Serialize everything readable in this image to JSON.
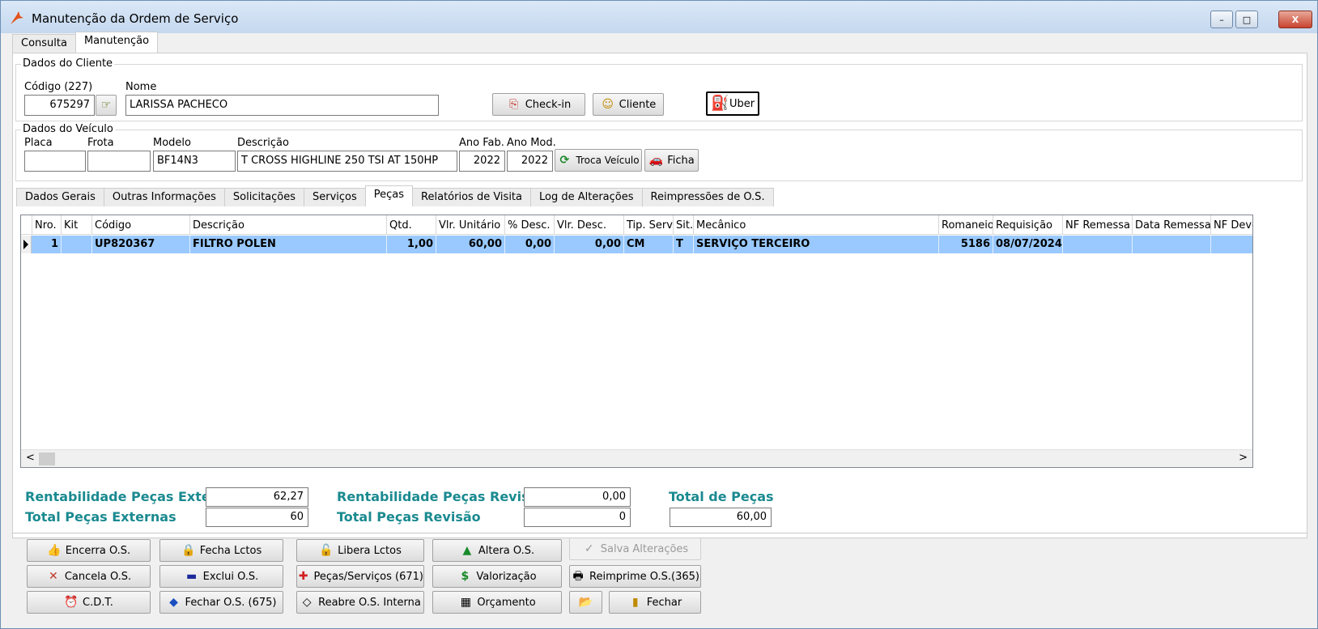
{
  "window": {
    "title": "Manutenção da Ordem de Serviço",
    "controls": [
      "–",
      "□",
      "X"
    ]
  },
  "top_tabs": [
    {
      "label": "Consulta",
      "active": false
    },
    {
      "label": "Manutenção",
      "active": true
    }
  ],
  "cliente": {
    "section_label": "Dados do Cliente",
    "codigo_label": "Código (227)",
    "codigo_value": "675297",
    "nome_label": "Nome",
    "nome_value": "LARISSA PACHECO",
    "buttons": {
      "checkin": "Check-in",
      "cliente": "Cliente",
      "uber": "Uber"
    }
  },
  "veiculo": {
    "section_label": "Dados do Veículo",
    "placa_label": "Placa",
    "placa_value": "",
    "frota_label": "Frota",
    "frota_value": "",
    "modelo_label": "Modelo",
    "modelo_value": "BF14N3",
    "descricao_label": "Descrição",
    "descricao_value": "T CROSS HIGHLINE 250 TSI AT 150HP",
    "ano_fab_label": "Ano Fab.",
    "ano_fab_value": "2022",
    "ano_mod_label": "Ano Mod.",
    "ano_mod_value": "2022",
    "troca_label": "Troca Veículo",
    "ficha_label": "Ficha"
  },
  "inner_tabs": [
    {
      "label": "Dados Gerais",
      "active": false
    },
    {
      "label": "Outras Informações",
      "active": false
    },
    {
      "label": "Solicitações",
      "active": false
    },
    {
      "label": "Serviços",
      "active": false
    },
    {
      "label": "Peças",
      "active": true
    },
    {
      "label": "Relatórios de Visita",
      "active": false
    },
    {
      "label": "Log de Alterações",
      "active": false
    },
    {
      "label": "Reimpressões de O.S.",
      "active": false
    }
  ],
  "grid": {
    "columns": [
      "Nro.",
      "Kit",
      "Código",
      "Descrição",
      "Qtd.",
      "Vlr. Unitário",
      "% Desc.",
      "Vlr. Desc.",
      "Tip. Serv.",
      "Sit.",
      "Mecânico",
      "Romaneio",
      "Requisição",
      "NF Remessa",
      "Data Remessa",
      "NF Devo"
    ],
    "rows": [
      [
        "1",
        "",
        "UP820367",
        "FILTRO POLEN",
        "1,00",
        "60,00",
        "0,00",
        "0,00",
        "CM",
        "T",
        "SERVIÇO TERCEIRO",
        "5186",
        "08/07/2024",
        "",
        "",
        ""
      ]
    ],
    "scroll_left": "<",
    "scroll_right": ">"
  },
  "summary": {
    "rent_externas_label": "Rentabilidade Peças Externas",
    "rent_externas_value": "62,27",
    "total_externas_label": "Total Peças Externas",
    "total_externas_value": "60",
    "rent_revisao_label": "Rentabilidade Peças Revisão",
    "rent_revisao_value": "0,00",
    "total_revisao_label": "Total Peças Revisão",
    "total_revisao_value": "0",
    "total_pecas_label": "Total de Peças",
    "total_pecas_value": "60,00"
  },
  "actions": {
    "encerra": "Encerra O.S.",
    "fecha_lctos": "Fecha Lctos",
    "libera_lctos": "Libera Lctos",
    "altera": "Altera O.S.",
    "salva": "Salva Alterações",
    "cancela": "Cancela O.S.",
    "exclui": "Exclui O.S.",
    "pecas_servicos": "Peças/Serviços (671)",
    "valorizacao": "Valorização",
    "reimprime": "Reimprime O.S.(365)",
    "cdt": "C.D.T.",
    "fechar_os": "Fechar O.S. (675)",
    "reabre": "Reabre O.S. Interna",
    "orcamento": "Orçamento",
    "fechar": "Fechar"
  },
  "colors": {
    "selection": "#99c9ff",
    "summary_text": "#1a8a90"
  }
}
